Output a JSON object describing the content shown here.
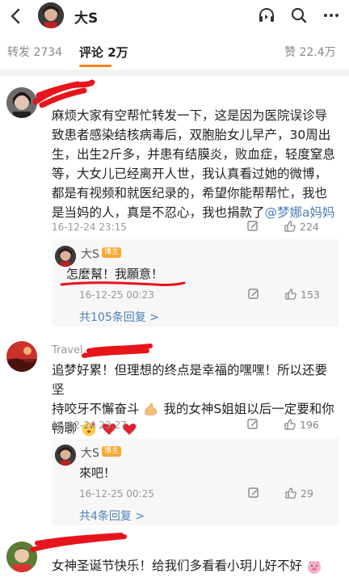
{
  "header": {
    "user_name": "大S"
  },
  "tabs": {
    "repost_label": "转发",
    "repost_count": "2734",
    "comment_label": "评论",
    "comment_count": "2万",
    "like_label": "赞",
    "like_count": "22.4万"
  },
  "comments": [
    {
      "text_main": "麻烦大家有空帮忙转发一下，这是因为医院误诊导致患者感染结核病毒后，双胞胎女儿早产，30周出生，出生2斤多，并患有结膜炎，败血症，轻度窒息等，大女儿已经离开人世，我认真看过她的微博，都是有视频和就医纪录的，希望你能帮帮忙，我也是当妈的人，真是不忍心，我也捐款了",
      "mention": "@梦娜a妈妈",
      "time": "16-12-24 23:15",
      "like_count": "224",
      "reply": {
        "name": "大S",
        "badge": "博主",
        "text": "怎麼幫！我願意！",
        "time": "16-12-25 00:23",
        "like_count": "153"
      },
      "more_replies": "共105条回复 >"
    },
    {
      "user_name_partial": "Travel...ry_cool",
      "text_line1": "追梦好累！但理想的终点是幸福的嘿嘿！所以还要坚",
      "text_line2": "持咬牙不懈奋斗",
      "text_line2b": "我的女神S姐姐以后一定要和你",
      "text_line3": "畅聊",
      "time": "16-12-24 23:27",
      "like_count": "196",
      "reply": {
        "name": "大S",
        "badge": "博主",
        "text": "來吧！",
        "time": "16-12-25 00:25",
        "like_count": "29"
      },
      "more_replies": "共4条回复 >"
    },
    {
      "text": "女神圣诞节快乐！给我们多看看小玥儿好不好"
    }
  ],
  "colors": {
    "accent": "#ff8200",
    "link": "#4e7fb5",
    "scribble": "#e8141c",
    "badge": "#f9a834"
  },
  "icons": [
    "back-arrow-icon",
    "listen-icon",
    "search-icon",
    "more-icon",
    "comment-icon",
    "like-icon",
    "muscle-emoji",
    "heart-emoji",
    "pig-emoji"
  ]
}
